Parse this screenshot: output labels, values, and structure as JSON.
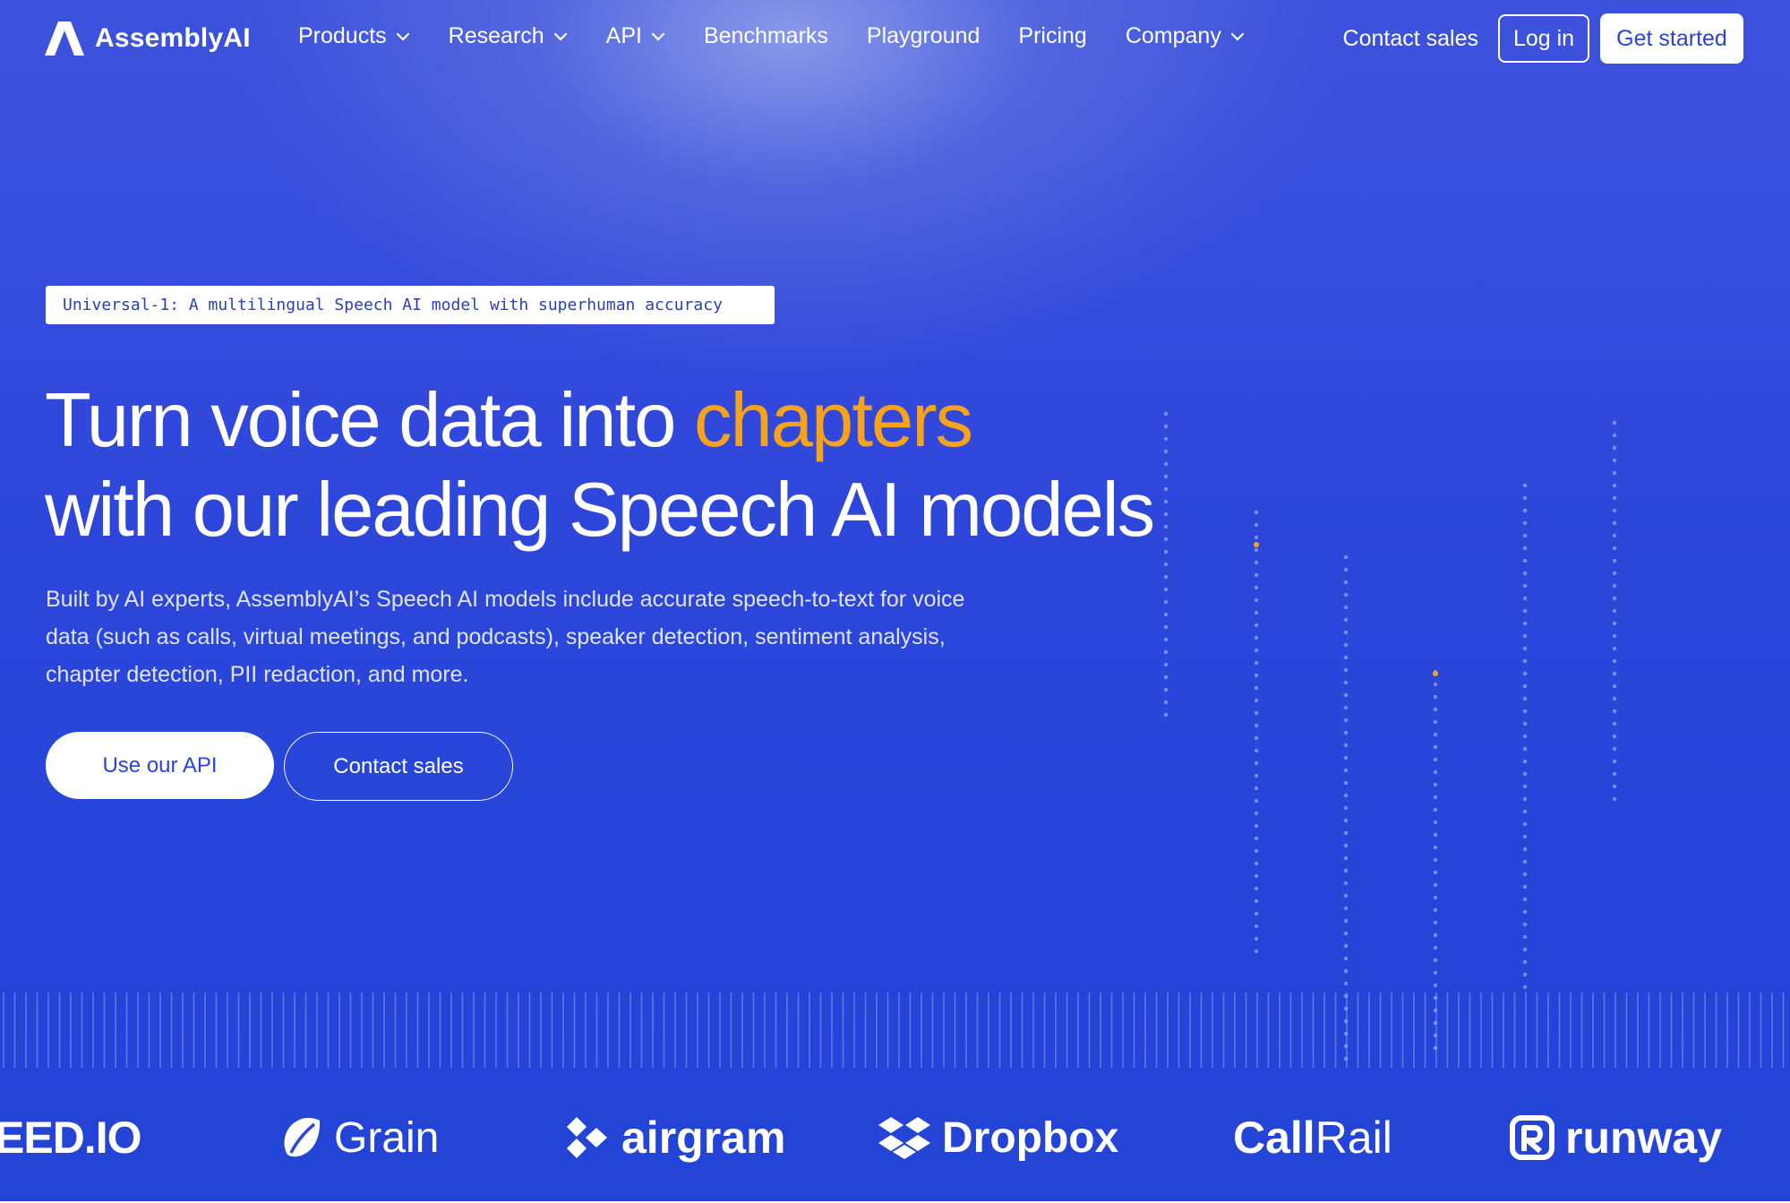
{
  "brand": {
    "name": "AssemblyAI",
    "logo_icon": "assemblyai-a-logo-icon"
  },
  "nav": {
    "items": [
      {
        "label": "Products",
        "dropdown": true
      },
      {
        "label": "Research",
        "dropdown": true
      },
      {
        "label": "API",
        "dropdown": true
      },
      {
        "label": "Benchmarks",
        "dropdown": false
      },
      {
        "label": "Playground",
        "dropdown": false
      },
      {
        "label": "Pricing",
        "dropdown": false
      },
      {
        "label": "Company",
        "dropdown": true
      }
    ],
    "contact_sales": "Contact sales",
    "login": "Log in",
    "get_started": "Get started"
  },
  "hero": {
    "badge": "Universal-1: A multilingual Speech AI model with superhuman accuracy",
    "headline_prefix": "Turn voice data into ",
    "headline_accent": "chapters",
    "headline_line2": "with our leading Speech AI models",
    "subtext": "Built by AI experts, AssemblyAI’s Speech AI models include accurate speech-to-text for voice data (such as calls, virtual meetings, and podcasts), speaker detection, sentiment analysis, chapter detection, PII redaction, and more.",
    "primary_cta": "Use our API",
    "secondary_cta": "Contact sales"
  },
  "customer_logos": [
    "EED.IO",
    "Grain",
    "airgram",
    "Dropbox",
    "Call",
    "Rail",
    "runway"
  ],
  "colors": {
    "background": "#2d47da",
    "accent": "#f7a21b",
    "text": "#ffffff",
    "button_text": "#2b44d6"
  }
}
